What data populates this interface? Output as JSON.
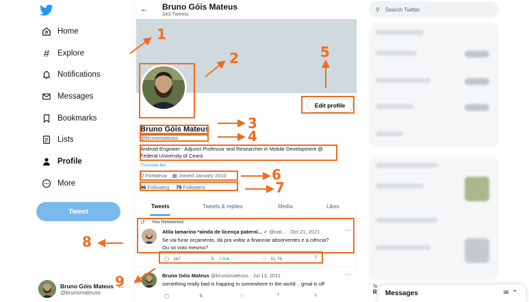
{
  "colors": {
    "annotation": "#f26b1d",
    "twitter_blue": "#1d9bf0",
    "tweet_button": "#7ab9ee",
    "retweet_green": "#00ba7c"
  },
  "logo": {
    "icon": "twitter-bird-icon"
  },
  "nav": [
    {
      "label": "Home",
      "icon": "home-icon"
    },
    {
      "label": "Explore",
      "icon": "hashtag-icon"
    },
    {
      "label": "Notifications",
      "icon": "bell-icon"
    },
    {
      "label": "Messages",
      "icon": "envelope-icon"
    },
    {
      "label": "Bookmarks",
      "icon": "bookmark-icon"
    },
    {
      "label": "Lists",
      "icon": "list-icon"
    },
    {
      "label": "Profile",
      "icon": "person-icon",
      "active": true
    },
    {
      "label": "More",
      "icon": "more-circle-icon"
    }
  ],
  "tweet_button": "Tweet",
  "account": {
    "name": "Bruno Góis Mateus",
    "handle": "@brunomateuss",
    "more": "..."
  },
  "header": {
    "name": "Bruno Góis Mateus",
    "tweet_count": "343 Tweets"
  },
  "profile": {
    "name": "Bruno Góis Mateus",
    "handle": "@brunomateuss",
    "bio": "Android Engineer  - Adjunct Professor  and Researcher in Mobile Development @ Federal University of Ceará",
    "translate": "Translate bio",
    "location": "Fortaleza",
    "joined": "Joined January 2010",
    "following_count": "96",
    "following_label": "Following",
    "followers_count": "79",
    "followers_label": "Followers",
    "edit_button": "Edit profile"
  },
  "tabs": [
    "Tweets",
    "Tweets & replies",
    "Media",
    "Likes"
  ],
  "tweets": [
    {
      "retweet_label": "You Retweeted",
      "author": "Atila Iamarino *ainda de licença paterni...",
      "handle": "@oat...",
      "date": "· Oct 21, 2021",
      "text_line1": "Se vai furar orçamento, dá pra voltar a financiar absorventes e a ciência?",
      "text_line2": "Ou só voto mesmo?",
      "replies": "267",
      "retweets": "7,006",
      "likes": "51.7K"
    },
    {
      "author": "Bruno Góis Mateus",
      "handle": "@brunomateuss",
      "date": "· Jul 13, 2011",
      "text_line1": "something really bad is happing in somewhere in the world .. gmal is off"
    }
  ],
  "search": {
    "placeholder": "Search Twitter"
  },
  "messages_drawer": {
    "title": "Messages"
  },
  "sidebar_fragment": {
    "line1": "Te",
    "line2": "R"
  },
  "annotations": [
    "1",
    "2",
    "3",
    "4",
    "5",
    "6",
    "7",
    "8",
    "9"
  ]
}
